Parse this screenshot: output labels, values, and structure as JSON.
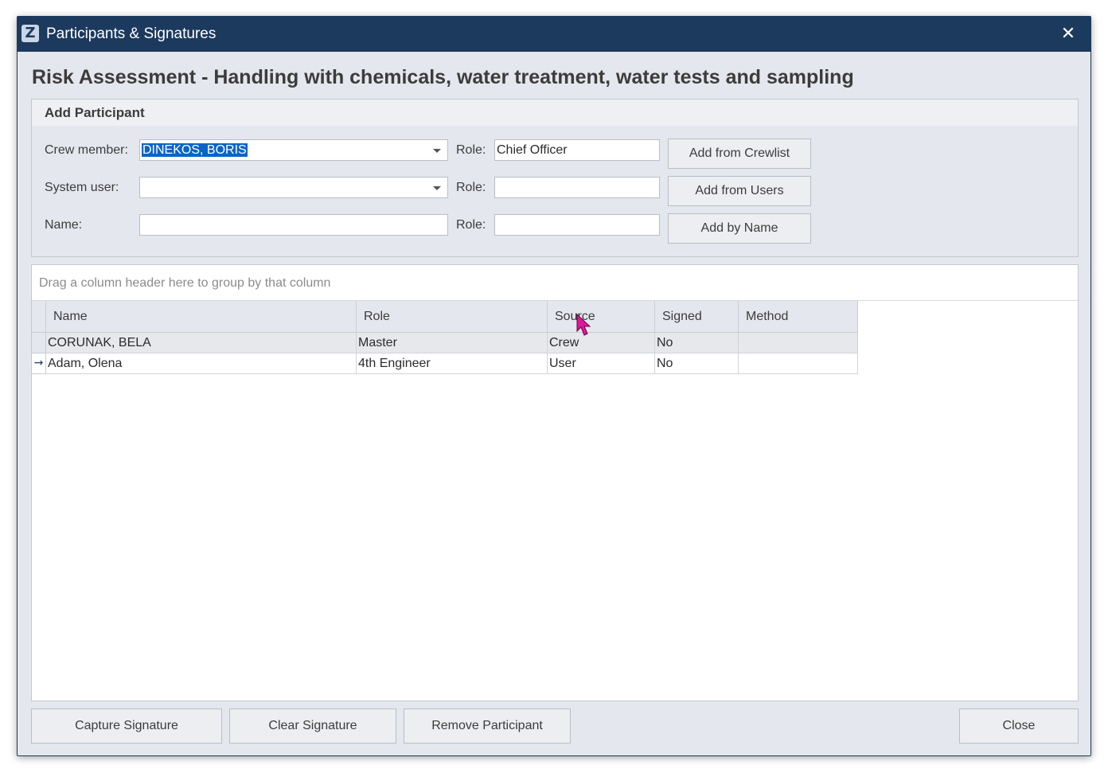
{
  "window": {
    "title": "Participants & Signatures",
    "app_icon_letter": "Z",
    "close_glyph": "✕"
  },
  "page_title": "Risk Assessment - Handling with chemicals, water treatment, water tests and sampling",
  "add_participant": {
    "title": "Add Participant",
    "crew_member": {
      "label": "Crew member:",
      "value": "DINEKOS, BORIS",
      "role_label": "Role:",
      "role_value": "Chief Officer",
      "button": "Add from Crewlist"
    },
    "system_user": {
      "label": "System user:",
      "value": "",
      "role_label": "Role:",
      "role_value": "",
      "button": "Add from Users"
    },
    "name": {
      "label": "Name:",
      "value": "",
      "role_label": "Role:",
      "role_value": "",
      "button": "Add by Name"
    }
  },
  "grid": {
    "group_hint": "Drag a column header here to group by that column",
    "columns": [
      "Name",
      "Role",
      "Source",
      "Signed",
      "Method"
    ],
    "rows": [
      {
        "name": "CORUNAK, BELA",
        "role": "Master",
        "source": "Crew",
        "signed": "No",
        "method": ""
      },
      {
        "name": "Adam, Olena",
        "role": "4th Engineer",
        "source": "User",
        "signed": "No",
        "method": ""
      }
    ],
    "current_row_indicator": "→"
  },
  "footer": {
    "capture_signature": "Capture Signature",
    "clear_signature": "Clear Signature",
    "remove_participant": "Remove Participant",
    "close": "Close"
  },
  "colors": {
    "titlebar": "#1c3a5e",
    "selection": "#0a64c8",
    "cursor": "#e0169e"
  },
  "icons": {
    "app": "app-logo-icon",
    "close": "close-icon",
    "dropdown": "chevron-down-icon",
    "row_indicator": "arrow-right-icon",
    "mouse": "mouse-cursor-icon"
  }
}
